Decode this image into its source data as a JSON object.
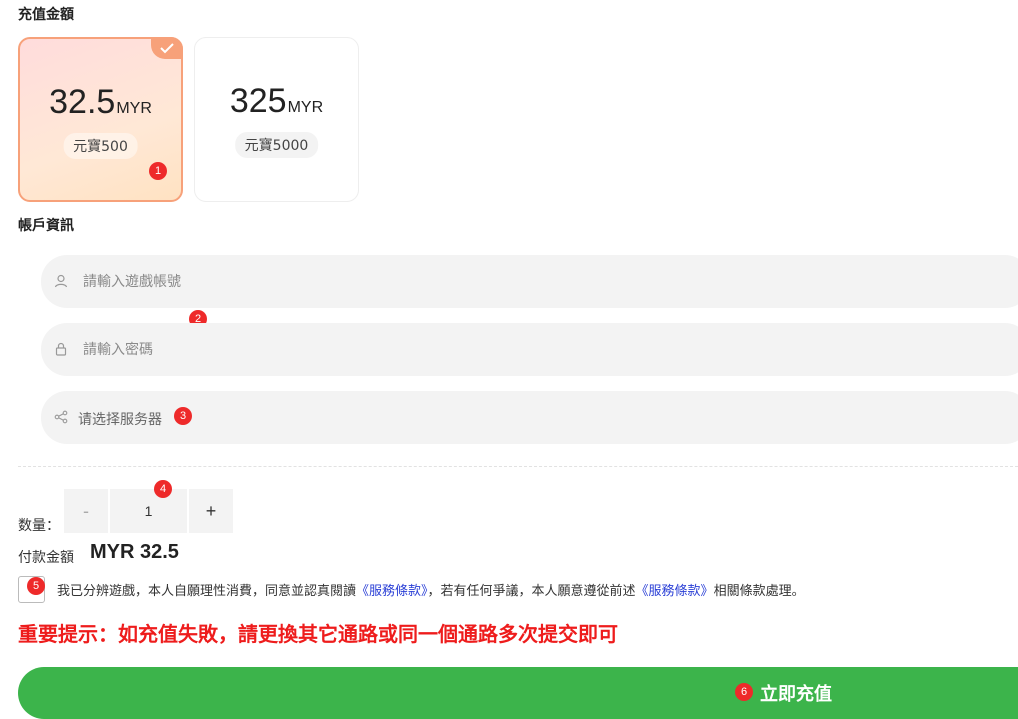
{
  "recharge": {
    "title": "充值金額",
    "options": [
      {
        "amount": "32.5",
        "currency": "MYR",
        "bonus": "元寶500",
        "selected": true
      },
      {
        "amount": "325",
        "currency": "MYR",
        "bonus": "元寶5000",
        "selected": false
      }
    ]
  },
  "account": {
    "title": "帳戶資訊",
    "username_placeholder": "請輸入遊戲帳號",
    "password_placeholder": "請輸入密碼",
    "server_placeholder": "请选择服务器"
  },
  "quantity": {
    "label": "数量：",
    "minus": "-",
    "value": "1",
    "plus": "+"
  },
  "payment": {
    "label": "付款金額",
    "value": "MYR 32.5"
  },
  "agreement": {
    "text_1": "我已分辨遊戲，本人自願理性消費，同意並認真閱讀",
    "terms_link_1": "《服務條款》",
    "text_2": "，若有任何爭議，本人願意遵從前述",
    "terms_link_2": "《服務條款》",
    "text_3": "相關條款處理。"
  },
  "warning": "重要提示：如充值失敗，請更換其它通路或同一個通路多次提交即可",
  "submit_label": "立即充值",
  "badges": [
    "1",
    "2",
    "3",
    "4",
    "5",
    "6"
  ],
  "colors": {
    "accent_orange": "#f7a17a",
    "badge_red": "#ee2a2a",
    "warning_red": "#ee1c1c",
    "submit_green": "#3cb44b",
    "link_blue": "#2a3fd6"
  },
  "icons": [
    "check-icon",
    "user-icon",
    "lock-icon",
    "share-icon"
  ]
}
